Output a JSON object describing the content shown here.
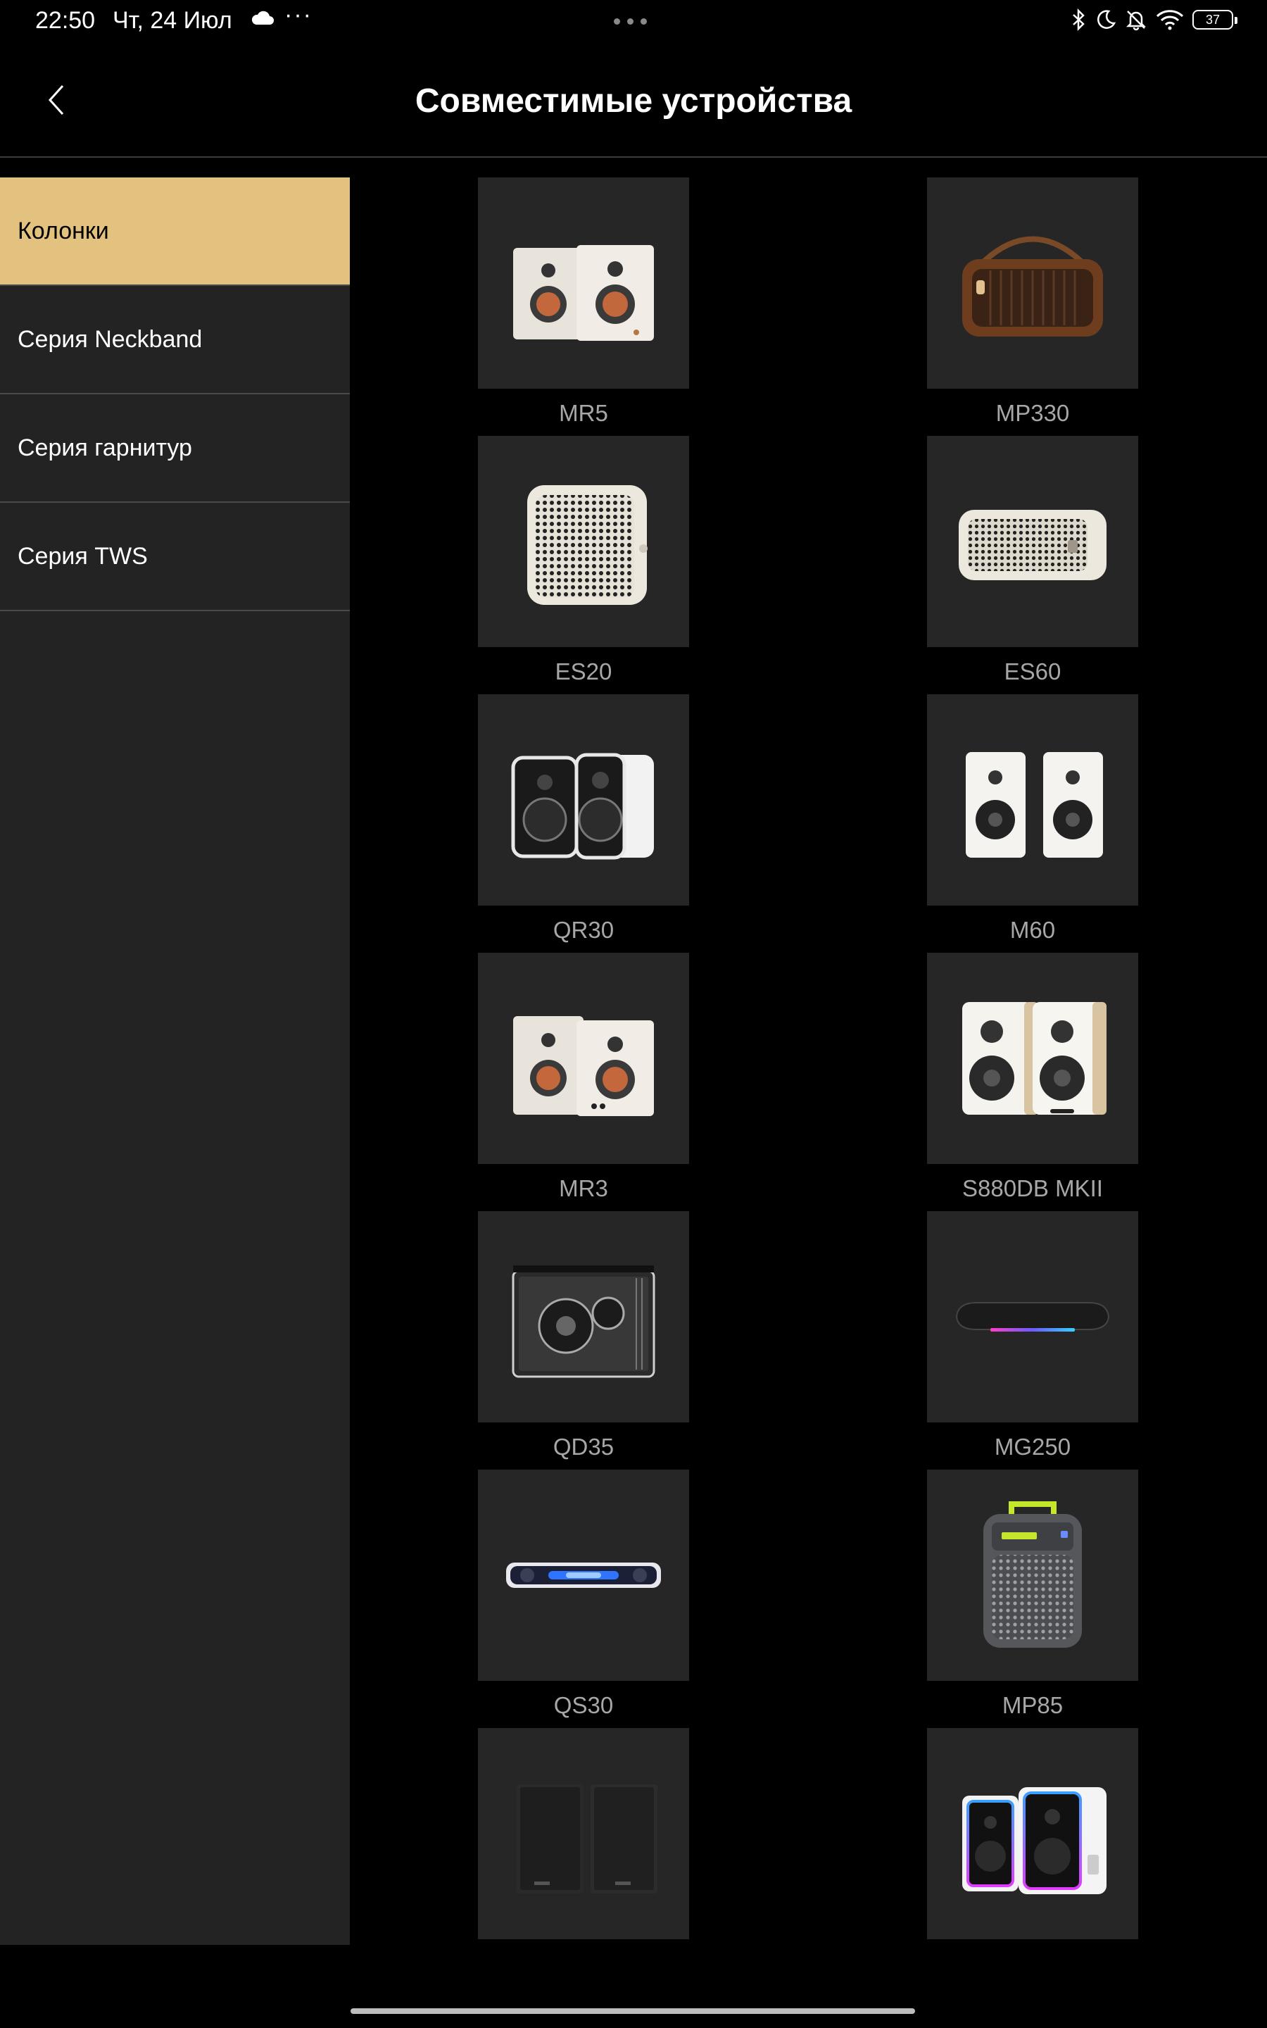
{
  "status_bar": {
    "time": "22:50",
    "date": "Чт, 24 Июл",
    "more": "···",
    "battery": "37"
  },
  "header": {
    "title": "Совместимые устройства"
  },
  "sidebar": {
    "items": [
      {
        "label": "Колонки",
        "active": true
      },
      {
        "label": "Серия Neckband",
        "active": false
      },
      {
        "label": "Серия гарнитур",
        "active": false
      },
      {
        "label": "Серия TWS",
        "active": false
      }
    ]
  },
  "colors": {
    "accent": "#e3c27f",
    "sidebar_bg": "#232323",
    "card_bg": "#262626",
    "label": "#a7a7a7"
  },
  "devices": [
    {
      "name": "MR5",
      "icon": "bookshelf-speakers-white-copper-icon"
    },
    {
      "name": "MP330",
      "icon": "retro-radio-speaker-icon"
    },
    {
      "name": "ES20",
      "icon": "cube-speaker-icon"
    },
    {
      "name": "ES60",
      "icon": "wide-speaker-icon"
    },
    {
      "name": "QR30",
      "icon": "glossy-speakers-icon"
    },
    {
      "name": "M60",
      "icon": "white-speakers-icon"
    },
    {
      "name": "MR3",
      "icon": "bookshelf-speakers-white-copper-icon"
    },
    {
      "name": "S880DB MKII",
      "icon": "wood-speakers-icon"
    },
    {
      "name": "QD35",
      "icon": "transparent-speaker-icon"
    },
    {
      "name": "MG250",
      "icon": "soundbar-rgb-icon"
    },
    {
      "name": "QS30",
      "icon": "soundbar-blue-icon"
    },
    {
      "name": "MP85",
      "icon": "portable-speaker-icon"
    },
    {
      "name": "",
      "icon": "black-speakers-icon"
    },
    {
      "name": "",
      "icon": "rgb-speakers-icon"
    }
  ]
}
